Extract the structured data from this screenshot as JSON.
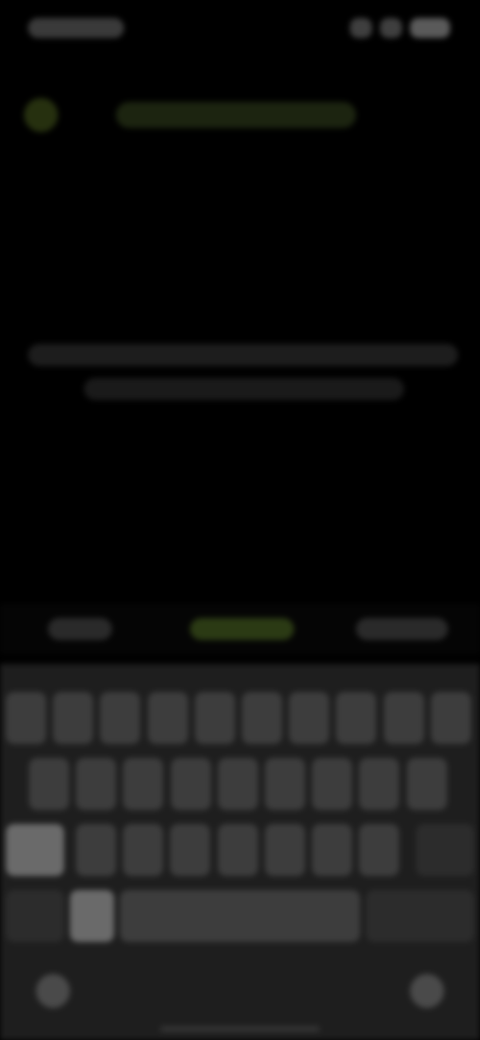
{
  "status_bar": {
    "time": "",
    "icons": [
      "signal-icon",
      "wifi-icon",
      "battery-icon"
    ]
  },
  "header": {
    "title": "",
    "accent_color": "#3f5a17"
  },
  "message": {
    "line1": "",
    "line2": ""
  },
  "suggestions": {
    "left": "",
    "middle": "",
    "right": "",
    "highlight_color": "#3f5a17"
  },
  "keyboard": {
    "rows": 4,
    "row1_keys": 10,
    "row2_keys": 9,
    "row3_keys": 9,
    "left_bottom_icon": "emoji-icon",
    "right_bottom_icon": "microphone-icon"
  }
}
